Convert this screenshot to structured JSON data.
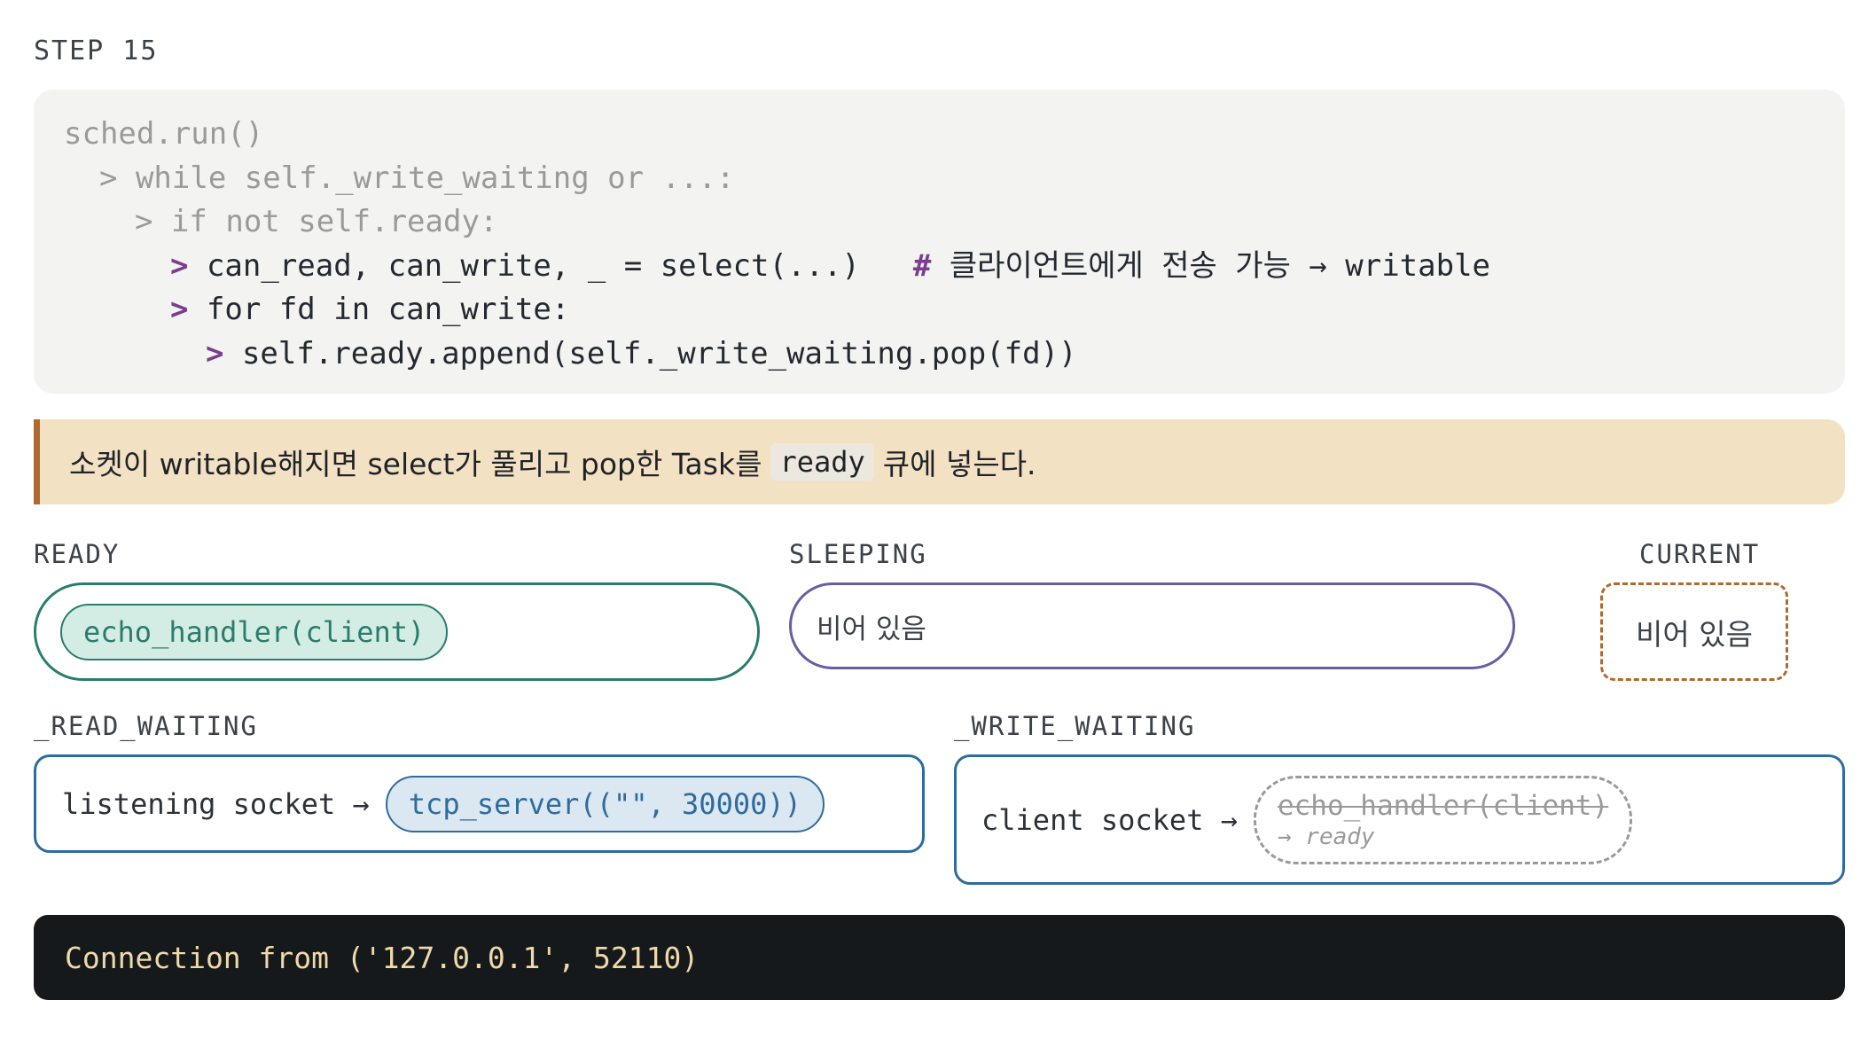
{
  "step": "STEP 15",
  "code": {
    "lines": [
      {
        "arrow": "",
        "text": "sched.run()",
        "dim": true
      },
      {
        "arrow": "> ",
        "text": "while self._write_waiting or ...:",
        "dim": true
      },
      {
        "arrow": "> ",
        "text": "if not self.ready:",
        "dim": true
      },
      {
        "arrow": "> ",
        "text": "can_read, can_write, _ = select(...)",
        "comment_hash": "#",
        "comment": " 클라이언트에게 전송 가능 → writable"
      },
      {
        "arrow": "> ",
        "text": "for fd in can_write:"
      },
      {
        "arrow": "> ",
        "text": "self.ready.append(self._write_waiting.pop(fd))"
      }
    ]
  },
  "callout": {
    "before": "소켓이 writable해지면 select가 풀리고 pop한 Task를",
    "code": "ready",
    "after": "큐에 넣는다."
  },
  "queues": {
    "ready": {
      "label": "READY",
      "items": [
        "echo_handler(client)"
      ]
    },
    "sleeping": {
      "label": "SLEEPING",
      "empty_text": "비어 있음"
    },
    "current": {
      "label": "CURRENT",
      "empty_text": "비어 있음"
    },
    "read_waiting": {
      "label": "_READ_WAITING",
      "fd_label": "listening socket →",
      "task": "tcp_server((\"\", 30000))"
    },
    "write_waiting": {
      "label": "_WRITE_WAITING",
      "fd_label": "client socket →",
      "task": "echo_handler(client)",
      "task_note": "→ ready"
    }
  },
  "terminal": {
    "output": "Connection from ('127.0.0.1', 52110)"
  },
  "colors": {
    "ready": "#2a7d6b",
    "sleeping": "#6a5ba3",
    "current": "#b0692f",
    "waiting": "#2e6b9e",
    "accent_arrow": "#7a3e8f",
    "callout_bg": "#f3e1c4",
    "terminal_bg": "#16191c"
  }
}
